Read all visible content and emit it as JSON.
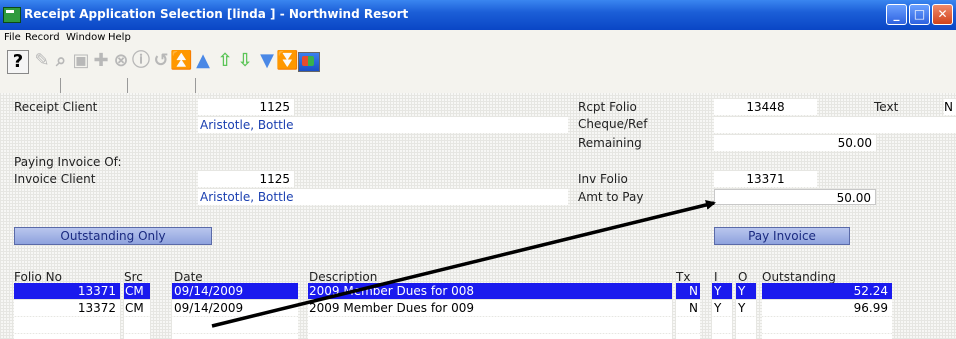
{
  "window": {
    "title": "Receipt Application Selection [linda   ] - Northwind Resort"
  },
  "menu": [
    "File",
    "Record",
    "Window",
    "Help"
  ],
  "toolbar": {
    "help_glyph": "?",
    "icons": [
      "help-icon",
      "edit-icon",
      "search-icon",
      "save-icon",
      "add-icon",
      "delete-icon",
      "info-icon",
      "undo-icon",
      "first-icon",
      "previous-icon",
      "next-green-icon",
      "down-green-icon",
      "next-icon",
      "last-icon",
      "window-icon"
    ]
  },
  "receipt": {
    "client_label": "Receipt Client",
    "client_id": "1125",
    "client_name": "Aristotle, Bottle",
    "rcpt_folio_label": "Rcpt Folio",
    "rcpt_folio": "13448",
    "text_label": "Text",
    "text_value": "N",
    "cheque_label": "Cheque/Ref",
    "cheque_value": "",
    "remaining_label": "Remaining",
    "remaining": "50.00"
  },
  "invoice": {
    "paying_label": "Paying Invoice Of:",
    "client_label": "Invoice Client",
    "client_id": "1125",
    "client_name": "Aristotle, Bottle",
    "inv_folio_label": "Inv Folio",
    "inv_folio": "13371",
    "amt_label": "Amt to Pay",
    "amt": "50.00"
  },
  "buttons": {
    "outstanding_only": "Outstanding Only",
    "pay_invoice": "Pay Invoice"
  },
  "grid": {
    "headers": {
      "folio": "Folio No",
      "src": "Src",
      "date": "Date",
      "desc": "Description",
      "tx": "Tx",
      "i": "I",
      "o": "O",
      "outstanding": "Outstanding"
    },
    "rows": [
      {
        "folio": "13371",
        "src": "CM",
        "date": "09/14/2009",
        "desc": "2009 Member Dues for 008",
        "tx": "N",
        "i": "Y",
        "o": "Y",
        "outstanding": "52.24"
      },
      {
        "folio": "13372",
        "src": "CM",
        "date": "09/14/2009",
        "desc": "2009 Member Dues for 009",
        "tx": "N",
        "i": "Y",
        "o": "Y",
        "outstanding": "96.99"
      }
    ]
  },
  "colors": {
    "titlebar": "#0a46c6",
    "selection": "#1a1aee",
    "button": "#8ea2de"
  }
}
